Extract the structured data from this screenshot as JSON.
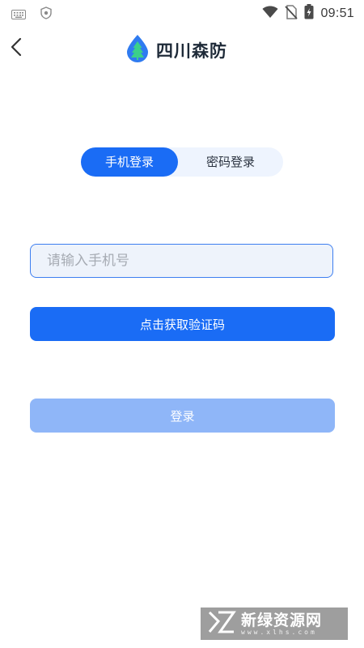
{
  "status_bar": {
    "time": "09:51",
    "left_icons": [
      "keyboard-icon",
      "shield-icon"
    ],
    "right_icons": [
      "wifi-icon",
      "no-sim-icon",
      "battery-icon"
    ]
  },
  "header": {
    "back_icon": "chevron-left-icon",
    "app_name": "四川森防",
    "logo_icon": "tree-drop-icon"
  },
  "tabs": [
    {
      "label": "手机登录",
      "active": true
    },
    {
      "label": "密码登录",
      "active": false
    }
  ],
  "phone_input": {
    "placeholder": "请输入手机号",
    "value": ""
  },
  "buttons": {
    "get_code": "点击获取验证码",
    "login": "登录"
  },
  "watermark": {
    "name": "新绿资源网",
    "url": "www.xlhs.com"
  },
  "colors": {
    "primary": "#1a6cf5",
    "primary_disabled": "#8fb6f8",
    "tab_bg": "#eef4fe",
    "input_bg": "#eef3fb",
    "input_border": "#3d7ef0"
  }
}
